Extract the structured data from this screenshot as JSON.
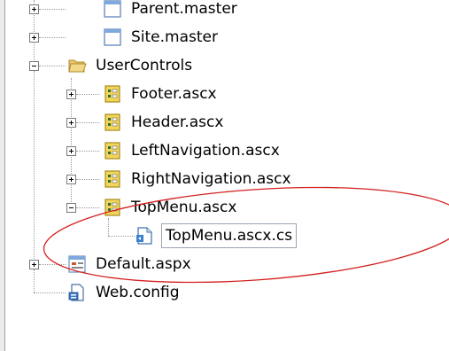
{
  "tree": {
    "nodes": [
      {
        "label": "Parent.master",
        "icon": "master-page-icon",
        "expander": "plus"
      },
      {
        "label": "Site.master",
        "icon": "master-page-icon",
        "expander": "plus"
      },
      {
        "label": "UserControls",
        "icon": "folder-open-icon",
        "expander": "minus"
      },
      {
        "label": "Footer.ascx",
        "icon": "user-control-icon",
        "expander": "plus"
      },
      {
        "label": "Header.ascx",
        "icon": "user-control-icon",
        "expander": "plus"
      },
      {
        "label": "LeftNavigation.ascx",
        "icon": "user-control-icon",
        "expander": "plus"
      },
      {
        "label": "RightNavigation.ascx",
        "icon": "user-control-icon",
        "expander": "plus"
      },
      {
        "label": "TopMenu.ascx",
        "icon": "user-control-icon",
        "expander": "minus"
      },
      {
        "label": "TopMenu.ascx.cs",
        "icon": "csharp-file-icon",
        "expander": "none",
        "selected": true
      },
      {
        "label": "Default.aspx",
        "icon": "web-form-icon",
        "expander": "plus"
      },
      {
        "label": "Web.config",
        "icon": "config-file-icon",
        "expander": "none"
      }
    ]
  },
  "colors": {
    "annotation_ellipse": "#d42020",
    "folder": "#f4d88a",
    "user_control": "#f2d65c",
    "selection_border": "#9aa4b0"
  }
}
